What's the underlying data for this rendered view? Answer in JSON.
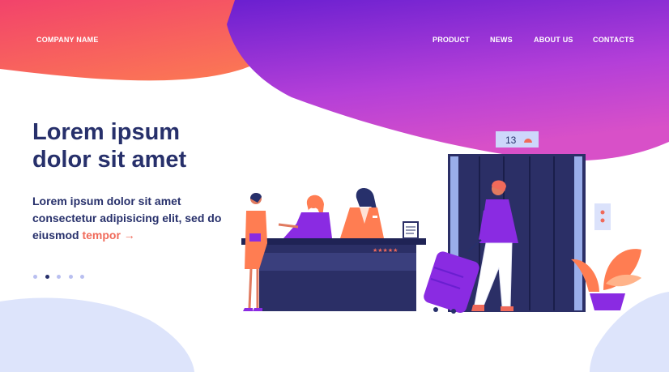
{
  "header": {
    "logo": "COMPANY NAME",
    "nav": [
      "PRODUCT",
      "NEWS",
      "ABOUT US",
      "CONTACTS"
    ]
  },
  "hero": {
    "title_line1": "Lorem ipsum",
    "title_line2": "dolor sit amet",
    "subtitle": "Lorem ipsum dolor sit amet consectetur adipisicing elit, sed do eiusmod",
    "link_text": "tempor →"
  },
  "carousel": {
    "total": 5,
    "active": 2
  },
  "illustration": {
    "elevator_floor": "13",
    "rating_stars": "★★★★★"
  },
  "colors": {
    "accent": "#f06a5a",
    "heading": "#27306b",
    "purple": "#8a2be2",
    "orange": "#ff7d52"
  }
}
